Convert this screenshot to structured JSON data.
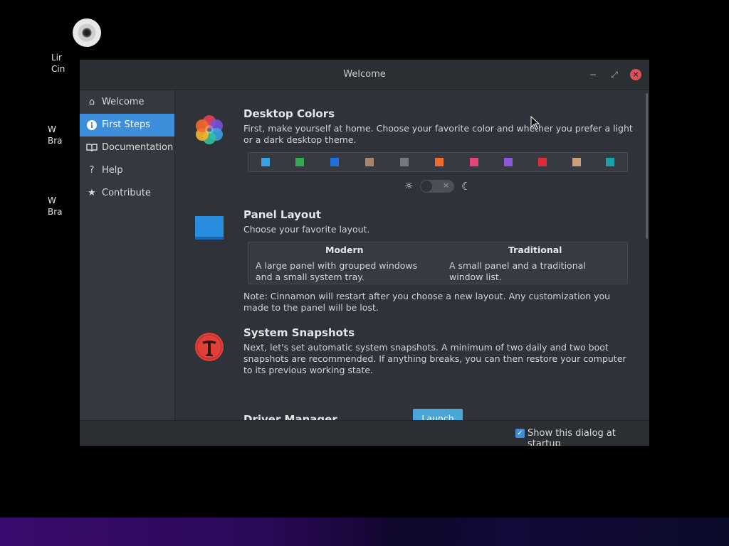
{
  "desktop": {
    "icon1_label": "Lir\nCin",
    "icon2_label": "W\nBra",
    "icon3_label": "W\nBra"
  },
  "window": {
    "title": "Welcome",
    "min_glyph": "−",
    "max_glyph": "⤢",
    "close_glyph": "×"
  },
  "sidebar": {
    "items": [
      {
        "label": "Welcome",
        "icon": "home-icon",
        "glyph": "⌂"
      },
      {
        "label": "First Steps",
        "icon": "info-icon",
        "glyph": "i"
      },
      {
        "label": "Documentation",
        "icon": "book-icon",
        "glyph": "▯"
      },
      {
        "label": "Help",
        "icon": "help-icon",
        "glyph": "?"
      },
      {
        "label": "Contribute",
        "icon": "star-icon",
        "glyph": "★"
      }
    ],
    "active_index": 1
  },
  "colors": {
    "accent": "#3d8fdc",
    "launch": "#48a6d8",
    "swatches": [
      "#3aa0e0",
      "#35a853",
      "#1f6fe0",
      "#a8856a",
      "#75787d",
      "#f06a2c",
      "#e4467a",
      "#8b5ad8",
      "#e02a35",
      "#c7a07a",
      "#1aa0a8"
    ]
  },
  "sections": {
    "desktop_colors": {
      "title": "Desktop Colors",
      "text": "First, make yourself at home. Choose your favorite color and whether you prefer a light or a dark desktop theme.",
      "sun_glyph": "☼",
      "moon_glyph": "☾",
      "toggle_x": "×"
    },
    "panel_layout": {
      "title": "Panel Layout",
      "text": "Choose your favorite layout.",
      "modern_title": "Modern",
      "modern_text": "A large panel with grouped windows and a small system tray.",
      "traditional_title": "Traditional",
      "traditional_text": "A small panel and a traditional window list.",
      "note": "Note: Cinnamon will restart after you choose a new layout. Any customization you made to the panel will be lost."
    },
    "system_snapshots": {
      "title": "System Snapshots",
      "text": "Next, let's set automatic system snapshots. A minimum of two daily and two boot snapshots are recommended. If anything breaks, you can then restore your computer to its previous working state.",
      "launch_label": "Launch"
    },
    "driver_manager": {
      "title": "Driver Manager"
    }
  },
  "footer": {
    "startup_label": "Show this dialog at startup",
    "startup_checked": true,
    "check_glyph": "✓"
  }
}
